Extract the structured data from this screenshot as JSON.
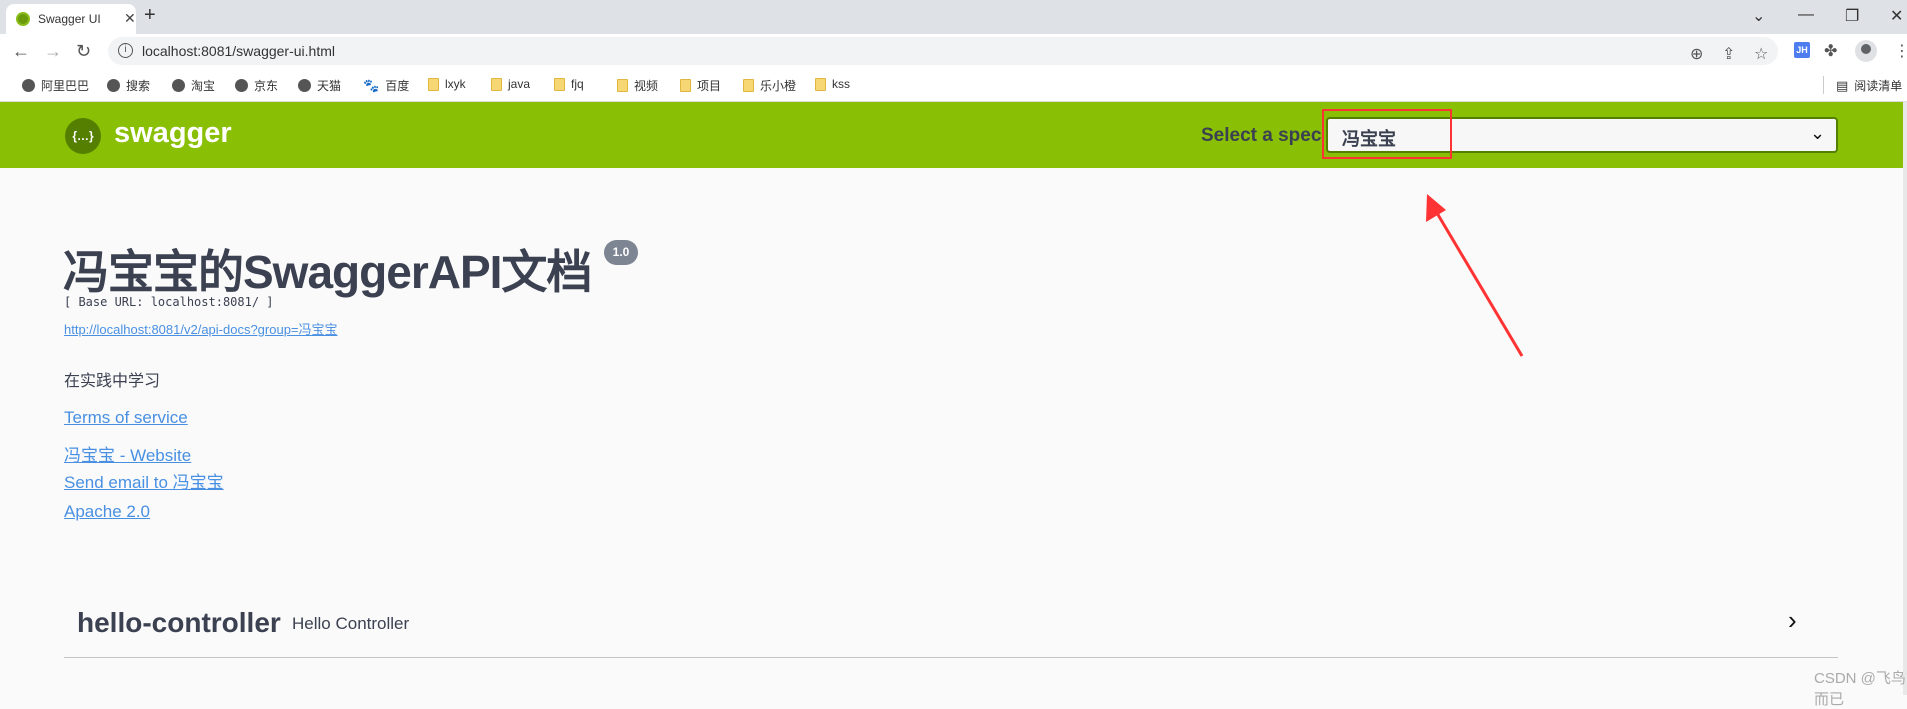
{
  "browser": {
    "tab_title": "Swagger UI",
    "url": "localhost:8081/swagger-ui.html",
    "extension_label": "JH",
    "bookmarks": [
      {
        "label": "阿里巴巴",
        "icon": "globe-icon"
      },
      {
        "label": "搜索",
        "icon": "globe-icon"
      },
      {
        "label": "淘宝",
        "icon": "globe-icon"
      },
      {
        "label": "京东",
        "icon": "globe-icon"
      },
      {
        "label": "天猫",
        "icon": "globe-icon"
      },
      {
        "label": "百度",
        "icon": "baidu-paw-icon"
      },
      {
        "label": "lxyk",
        "icon": "folder-icon"
      },
      {
        "label": "java",
        "icon": "folder-icon"
      },
      {
        "label": "fjq",
        "icon": "folder-icon"
      },
      {
        "label": "视频",
        "icon": "folder-icon"
      },
      {
        "label": "项目",
        "icon": "folder-icon"
      },
      {
        "label": "乐小橙",
        "icon": "folder-icon"
      },
      {
        "label": "kss",
        "icon": "folder-icon"
      }
    ],
    "reading_list": "阅读清单"
  },
  "header": {
    "logo_text": "swagger",
    "logo_glyph": "{…}",
    "spec_label": "Select a spec",
    "spec_value": "冯宝宝",
    "brand_color": "#89bf04"
  },
  "info": {
    "title": "冯宝宝的SwaggerAPI文档",
    "version": "1.0",
    "base_url": "[ Base URL: localhost:8081/ ]",
    "api_docs_link": "http://localhost:8081/v2/api-docs?group=冯宝宝",
    "description": "在实践中学习",
    "terms": "Terms of service",
    "website": "冯宝宝 - Website",
    "email": "Send email to 冯宝宝",
    "license": "Apache 2.0"
  },
  "tags": [
    {
      "name": "hello-controller",
      "description": "Hello Controller"
    }
  ],
  "watermark": "CSDN @飞鸟而已",
  "annotation_color": "#ff3333"
}
